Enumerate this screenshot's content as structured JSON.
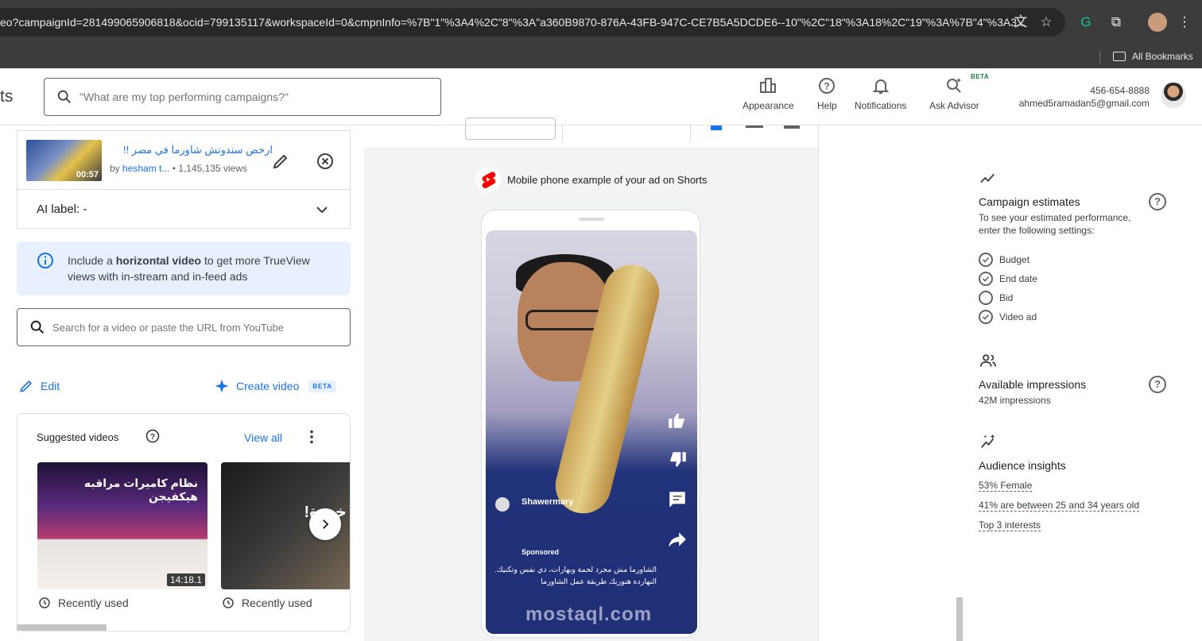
{
  "browser": {
    "url": "eo?campaignId=281499065906818&ocid=799135117&workspaceId=0&cmpnInfo=%7B\"1\"%3A4%2C\"8\"%3A\"a360B9870-876A-43FB-947C-CE7B5A5DCDE6--10\"%2C\"18\"%3A18%2C\"19\"%3A%7B\"4\"%3A3...",
    "bookmarks_label": "All Bookmarks"
  },
  "header": {
    "app_title_fragment": "ts",
    "search_placeholder": "\"What are my top performing campaigns?\"",
    "appearance": "Appearance",
    "help": "Help",
    "notifications": "Notifications",
    "ask_advisor": "Ask Advisor",
    "beta": "BETA",
    "phone": "456-654-8888",
    "email": "ahmed5ramadan5@gmail.com"
  },
  "video": {
    "title": "ارخص سندوتش شاورما في مصر !!",
    "duration": "00:57",
    "by": "by",
    "channel": "hesham t...",
    "views": "• 1,145,135 views",
    "ai_label": "AI label: -"
  },
  "info": {
    "pre": "Include a ",
    "bold": "horizontal video",
    "post": " to get more TrueView views with in-stream and in-feed ads"
  },
  "yt_search": {
    "placeholder": "Search for a video or paste the URL from YouTube"
  },
  "actions": {
    "edit": "Edit",
    "create_video": "Create video",
    "beta": "BETA"
  },
  "suggested": {
    "title": "Suggested videos",
    "view_all": "View all",
    "items": [
      {
        "overlay": "نظام كاميرات مراقبه هيكفيجن",
        "duration": "14:18.1",
        "status": "Recently used"
      },
      {
        "overlay": "خبرة!",
        "status": "Recently used"
      }
    ]
  },
  "preview": {
    "label": "Mobile phone example of your ad on Shorts",
    "channel": "Shawermary",
    "sponsored": "Sponsored",
    "ad_text": "الشاورما مش مجرد لحمة وبهارات، دي نفس وتكنيك. النهارده هنوريك طريقة عمل الشاورما",
    "watermark": "mostaql.com"
  },
  "estimates": {
    "title": "Campaign estimates",
    "subtitle": "To see your estimated performance, enter the following settings:",
    "settings": [
      {
        "label": "Budget",
        "done": true
      },
      {
        "label": "End date",
        "done": true
      },
      {
        "label": "Bid",
        "done": false
      },
      {
        "label": "Video ad",
        "done": true
      }
    ]
  },
  "impressions": {
    "title": "Available impressions",
    "value": "42M impressions"
  },
  "insights": {
    "title": "Audience insights",
    "female": "53% Female",
    "age": "41% are between 25 and 34 years old",
    "interests": "Top 3 interests"
  }
}
